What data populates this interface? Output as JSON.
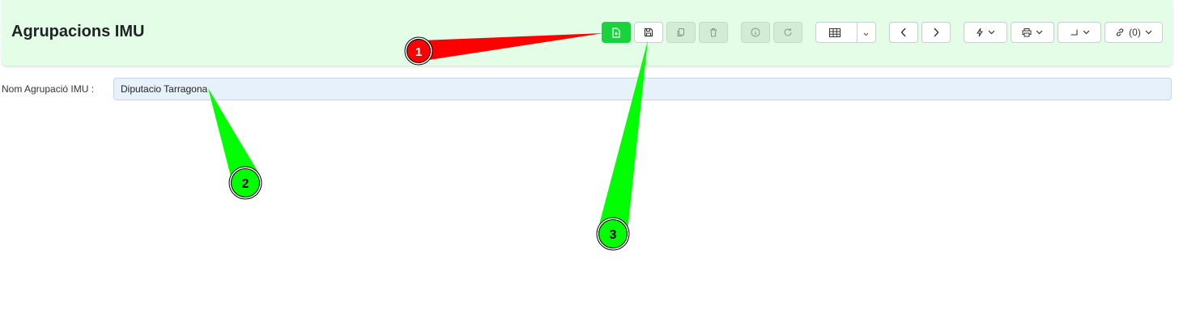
{
  "header": {
    "title": "Agrupacions IMU",
    "links_label": "(0)"
  },
  "toolbar": {
    "icons": [
      "file-plus-icon",
      "save-icon",
      "copy-icon",
      "trash-icon",
      "info-icon",
      "refresh-icon",
      "grid-icon",
      "chevron-down-icon",
      "chevron-left-icon",
      "chevron-right-icon",
      "lightning-icon",
      "printer-icon",
      "return-arrow-icon",
      "link-icon"
    ],
    "colors": {
      "primary": "#19d33c",
      "header_bg": "#e3fde6"
    }
  },
  "form": {
    "label": "Nom Agrupació IMU :",
    "value": "Diputacio Tarragona"
  },
  "annotations": [
    {
      "number": "1",
      "color": "#ff0000"
    },
    {
      "number": "2",
      "color": "#00ff00"
    },
    {
      "number": "3",
      "color": "#00ff00"
    }
  ]
}
